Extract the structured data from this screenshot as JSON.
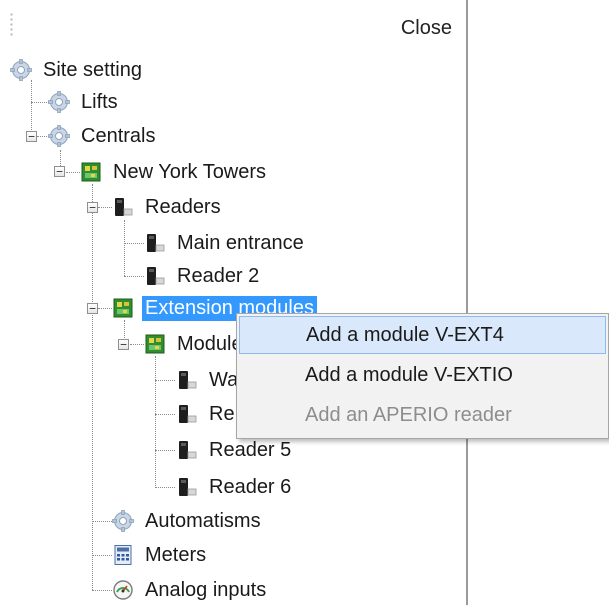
{
  "toolbar": {
    "close_label": "Close"
  },
  "tree": {
    "site_setting": "Site setting",
    "lifts": "Lifts",
    "centrals": "Centrals",
    "new_york_towers": "New York Towers",
    "readers": "Readers",
    "main_entrance": "Main entrance",
    "reader2": "Reader 2",
    "extension_modules": "Extension modules",
    "module": "Module",
    "wa": "Wa",
    "re": "Re",
    "reader5": "Reader 5",
    "reader6": "Reader 6",
    "automatisms": "Automatisms",
    "meters": "Meters",
    "analog_inputs": "Analog inputs"
  },
  "context_menu": {
    "items": [
      {
        "label": "Add a module V-EXT4",
        "state": "hover"
      },
      {
        "label": "Add a module V-EXTIO",
        "state": "normal"
      },
      {
        "label": "Add an APERIO reader",
        "state": "disabled"
      }
    ]
  },
  "colors": {
    "selection": "#3399ff",
    "menu_hover": "#d9e9fb",
    "menu_background": "#f2f2f2"
  }
}
